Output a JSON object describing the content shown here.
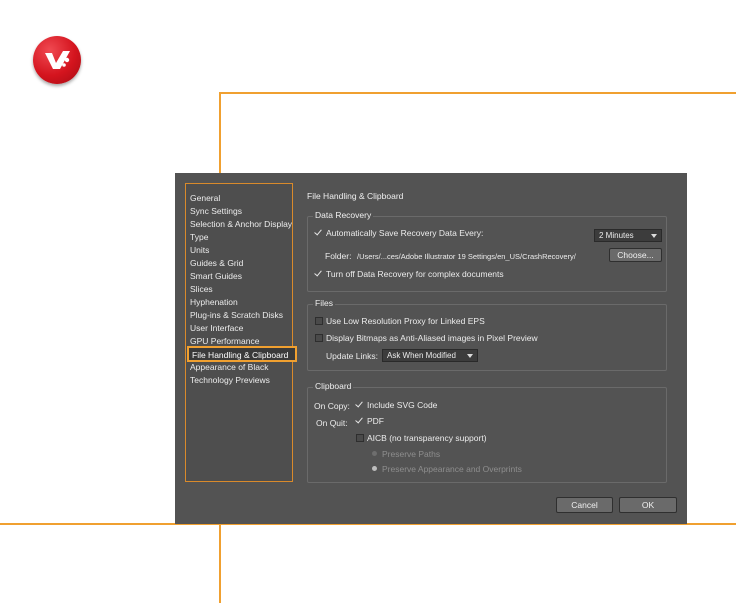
{
  "brand": {
    "accent": "#f0a030",
    "logo_red": "#d4141e"
  },
  "nav": {
    "items": [
      {
        "label": "General"
      },
      {
        "label": "Sync Settings"
      },
      {
        "label": "Selection & Anchor Display"
      },
      {
        "label": "Type"
      },
      {
        "label": "Units"
      },
      {
        "label": "Guides & Grid"
      },
      {
        "label": "Smart Guides"
      },
      {
        "label": "Slices"
      },
      {
        "label": "Hyphenation"
      },
      {
        "label": "Plug-ins & Scratch Disks"
      },
      {
        "label": "User Interface"
      },
      {
        "label": "GPU Performance"
      },
      {
        "label": "File Handling & Clipboard",
        "selected": true
      },
      {
        "label": "Appearance of Black"
      },
      {
        "label": "Technology Previews"
      }
    ]
  },
  "title": "File Handling & Clipboard",
  "data_recovery": {
    "label": "Data Recovery",
    "auto_save": {
      "label": "Automatically Save Recovery Data Every:",
      "checked": true
    },
    "interval": {
      "value": "2 Minutes"
    },
    "folder_label": "Folder:",
    "folder_path": "/Users/...ces/Adobe Illustrator 19 Settings/en_US/CrashRecovery/",
    "choose_button": "Choose...",
    "turn_off": {
      "label": "Turn off Data Recovery for complex documents",
      "checked": true
    }
  },
  "files": {
    "label": "Files",
    "low_res_proxy": {
      "label": "Use Low Resolution Proxy for Linked EPS",
      "checked": false
    },
    "anti_aliased": {
      "label": "Display Bitmaps as Anti-Aliased images in Pixel Preview",
      "checked": false
    },
    "update_links_label": "Update Links:",
    "update_links_value": "Ask When Modified"
  },
  "clipboard": {
    "label": "Clipboard",
    "on_copy_label": "On Copy:",
    "include_svg": {
      "label": "Include SVG Code",
      "checked": true
    },
    "on_quit_label": "On Quit:",
    "pdf": {
      "label": "PDF",
      "checked": true
    },
    "aicb": {
      "label": "AICB (no transparency support)",
      "checked": false
    },
    "preserve_paths": {
      "label": "Preserve Paths",
      "selected": false
    },
    "preserve_appearance": {
      "label": "Preserve Appearance and Overprints",
      "selected": true
    }
  },
  "buttons": {
    "cancel": "Cancel",
    "ok": "OK"
  }
}
